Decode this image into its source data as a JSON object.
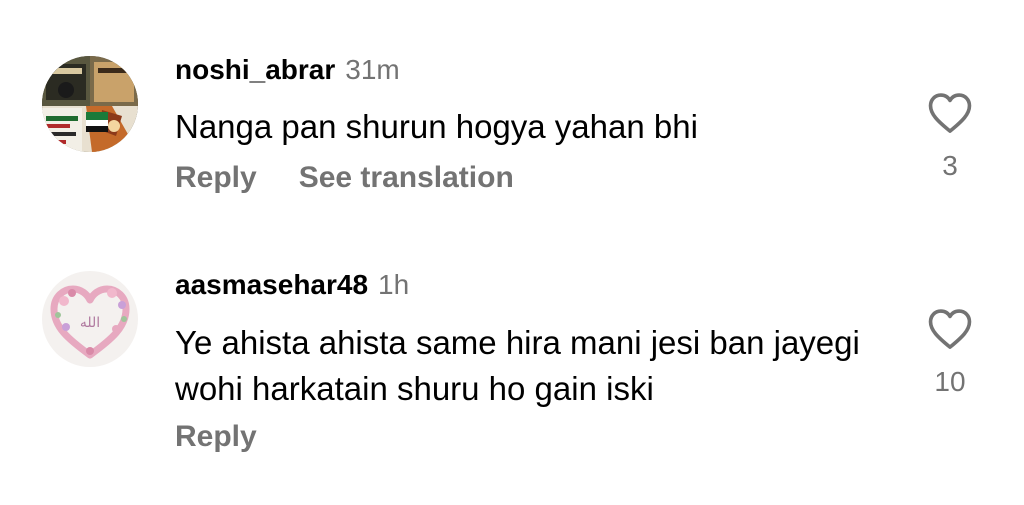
{
  "comments": [
    {
      "username": "noshi_abrar",
      "time": "31m",
      "text": "Nanga pan shurun hogya yahan bhi",
      "reply_label": "Reply",
      "translation_label": "See translation",
      "like_count": "3",
      "like_icon": "heart-outline-icon",
      "avatar_icon": "collage-avatar"
    },
    {
      "username": "aasmasehar48",
      "time": "1h",
      "text": "Ye ahista ahista same hira mani jesi ban jayegi wohi harkatain shuru ho gain iski",
      "reply_label": "Reply",
      "like_count": "10",
      "like_icon": "heart-outline-icon",
      "avatar_icon": "flower-heart-avatar",
      "avatar_text": "الله"
    }
  ],
  "colors": {
    "secondary_text": "#737373",
    "primary_text": "#000000",
    "background": "#ffffff"
  }
}
